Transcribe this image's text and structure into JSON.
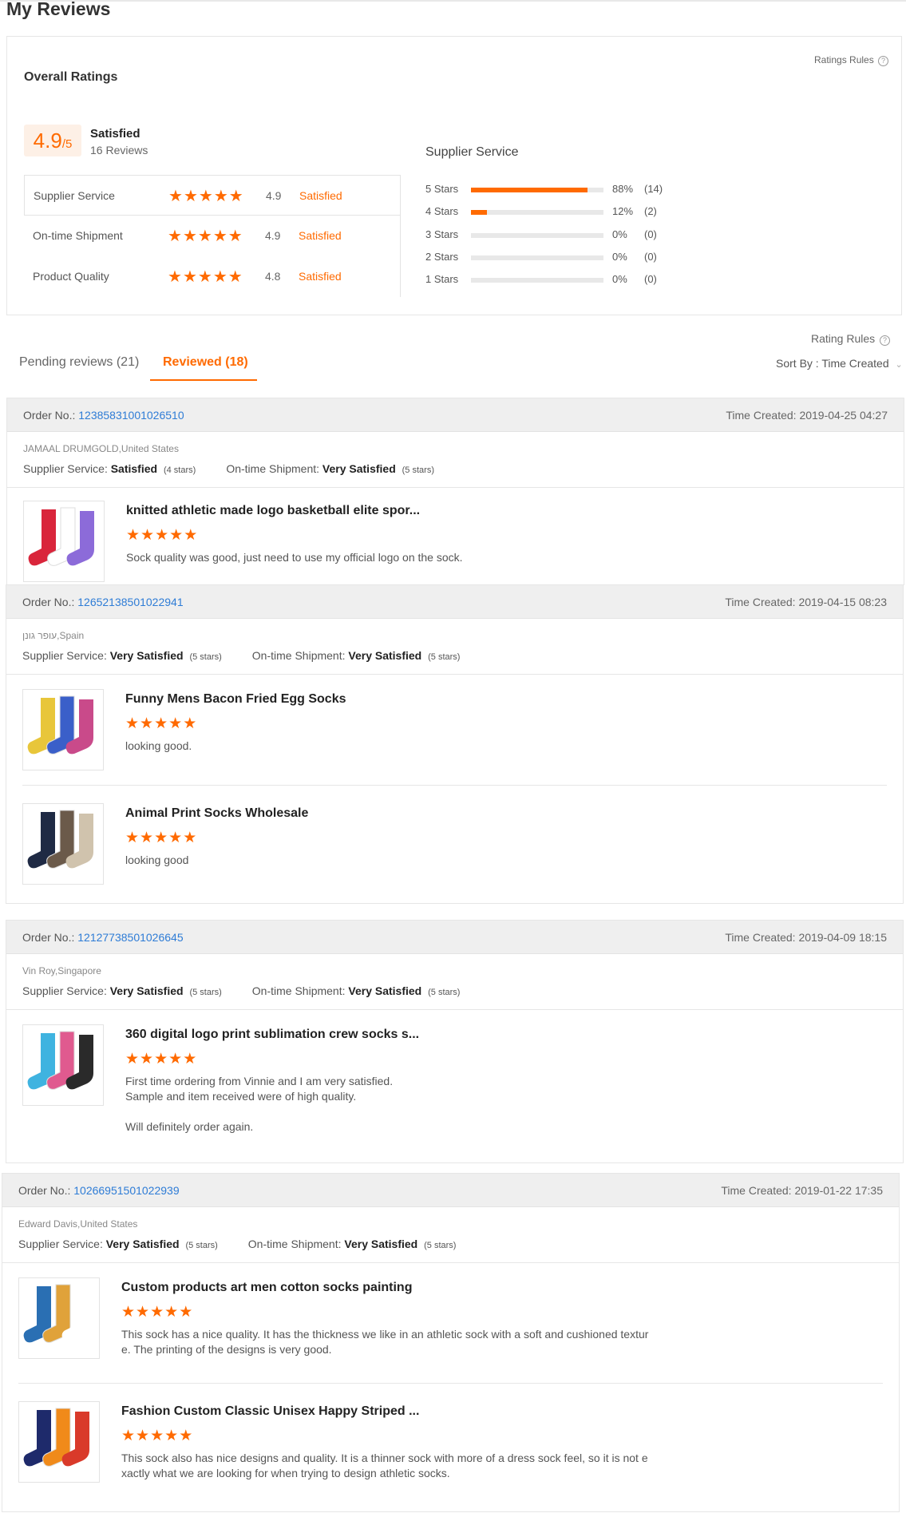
{
  "page": {
    "title": "My Reviews"
  },
  "overall": {
    "heading": "Overall Ratings",
    "rules_link": "Ratings Rules",
    "score": "4.9",
    "score_suffix": "/5",
    "satisfaction": "Satisfied",
    "review_count": "16 Reviews",
    "rows": [
      {
        "label": "Supplier Service",
        "stars": 5,
        "score": "4.9",
        "status": "Satisfied"
      },
      {
        "label": "On-time Shipment",
        "stars": 5,
        "score": "4.9",
        "status": "Satisfied"
      },
      {
        "label": "Product Quality",
        "stars": 5,
        "score": "4.8",
        "status": "Satisfied"
      }
    ],
    "breakdown_title": "Supplier Service",
    "breakdown": [
      {
        "label": "5 Stars",
        "fraction": 0.88,
        "pct": "88%",
        "count": "(14)"
      },
      {
        "label": "4 Stars",
        "fraction": 0.12,
        "pct": "12%",
        "count": "(2)"
      },
      {
        "label": "3 Stars",
        "fraction": 0,
        "pct": "0%",
        "count": "(0)"
      },
      {
        "label": "2 Stars",
        "fraction": 0,
        "pct": "0%",
        "count": "(0)"
      },
      {
        "label": "1 Stars",
        "fraction": 0,
        "pct": "0%",
        "count": "(0)"
      }
    ]
  },
  "tabs": {
    "pending": "Pending reviews (21)",
    "reviewed": "Reviewed (18)",
    "active": "reviewed",
    "rating_rules": "Rating Rules",
    "sort_label": "Sort By : Time Created"
  },
  "labels": {
    "order_no": "Order No.:",
    "time_created": "Time Created:",
    "supplier_service": "Supplier Service:",
    "ontime_shipment": "On-time Shipment:"
  },
  "orders": [
    {
      "order_no": "12385831001026510",
      "time": "2019-04-25 04:27",
      "buyer": "JAMAAL DRUMGOLD,United States",
      "supplier_rating": "Satisfied",
      "supplier_stars": "(4 stars)",
      "shipment_rating": "Very Satisfied",
      "shipment_stars": "(5 stars)",
      "items": [
        {
          "title": "knitted athletic made logo basketball elite spor...",
          "stars": 5,
          "comment": [
            "Sock quality was good, just need to use my official logo on the sock."
          ]
        }
      ]
    },
    {
      "order_no": "12652138501022941",
      "time": "2019-04-15 08:23",
      "buyer": "עופר גונן,Spain",
      "supplier_rating": "Very Satisfied",
      "supplier_stars": "(5 stars)",
      "shipment_rating": "Very Satisfied",
      "shipment_stars": "(5 stars)",
      "items": [
        {
          "title": "Funny Mens Bacon Fried Egg Socks",
          "stars": 5,
          "comment": [
            "looking good."
          ]
        },
        {
          "title": "Animal Print Socks Wholesale",
          "stars": 5,
          "comment": [
            "looking good"
          ]
        }
      ]
    },
    {
      "order_no": "12127738501026645",
      "time": "2019-04-09 18:15",
      "buyer": "Vin Roy,Singapore",
      "supplier_rating": "Very Satisfied",
      "supplier_stars": "(5 stars)",
      "shipment_rating": "Very Satisfied",
      "shipment_stars": "(5 stars)",
      "items": [
        {
          "title": "360 digital logo print sublimation crew socks s...",
          "stars": 5,
          "comment": [
            "First time ordering from Vinnie and I am very satisfied.",
            "Sample and item received were of high quality.",
            "",
            "Will definitely order again."
          ]
        }
      ]
    },
    {
      "order_no": "10266951501022939",
      "time": "2019-01-22 17:35",
      "buyer": "Edward Davis,United States",
      "supplier_rating": "Very Satisfied",
      "supplier_stars": "(5 stars)",
      "shipment_rating": "Very Satisfied",
      "shipment_stars": "(5 stars)",
      "items": [
        {
          "title": "Custom products art men cotton socks painting",
          "stars": 5,
          "comment": [
            "This sock has a nice quality. It has the thickness we like in an athletic sock with a soft and cushioned textur",
            "e. The printing of the designs is very good."
          ]
        },
        {
          "title": "Fashion Custom Classic Unisex Happy Striped ...",
          "stars": 5,
          "comment": [
            "This sock also has nice designs and quality. It is a thinner sock with more of a dress sock feel, so it is not e",
            "xactly what we are looking for when trying to design athletic socks."
          ]
        }
      ]
    }
  ],
  "colors": {
    "accent": "#ff6a00",
    "link": "#2e7cd6",
    "header_bg": "#efefef"
  },
  "icons": {
    "help": "help-circle-icon",
    "sort": "chevron-down-icon",
    "star": "star-icon"
  }
}
